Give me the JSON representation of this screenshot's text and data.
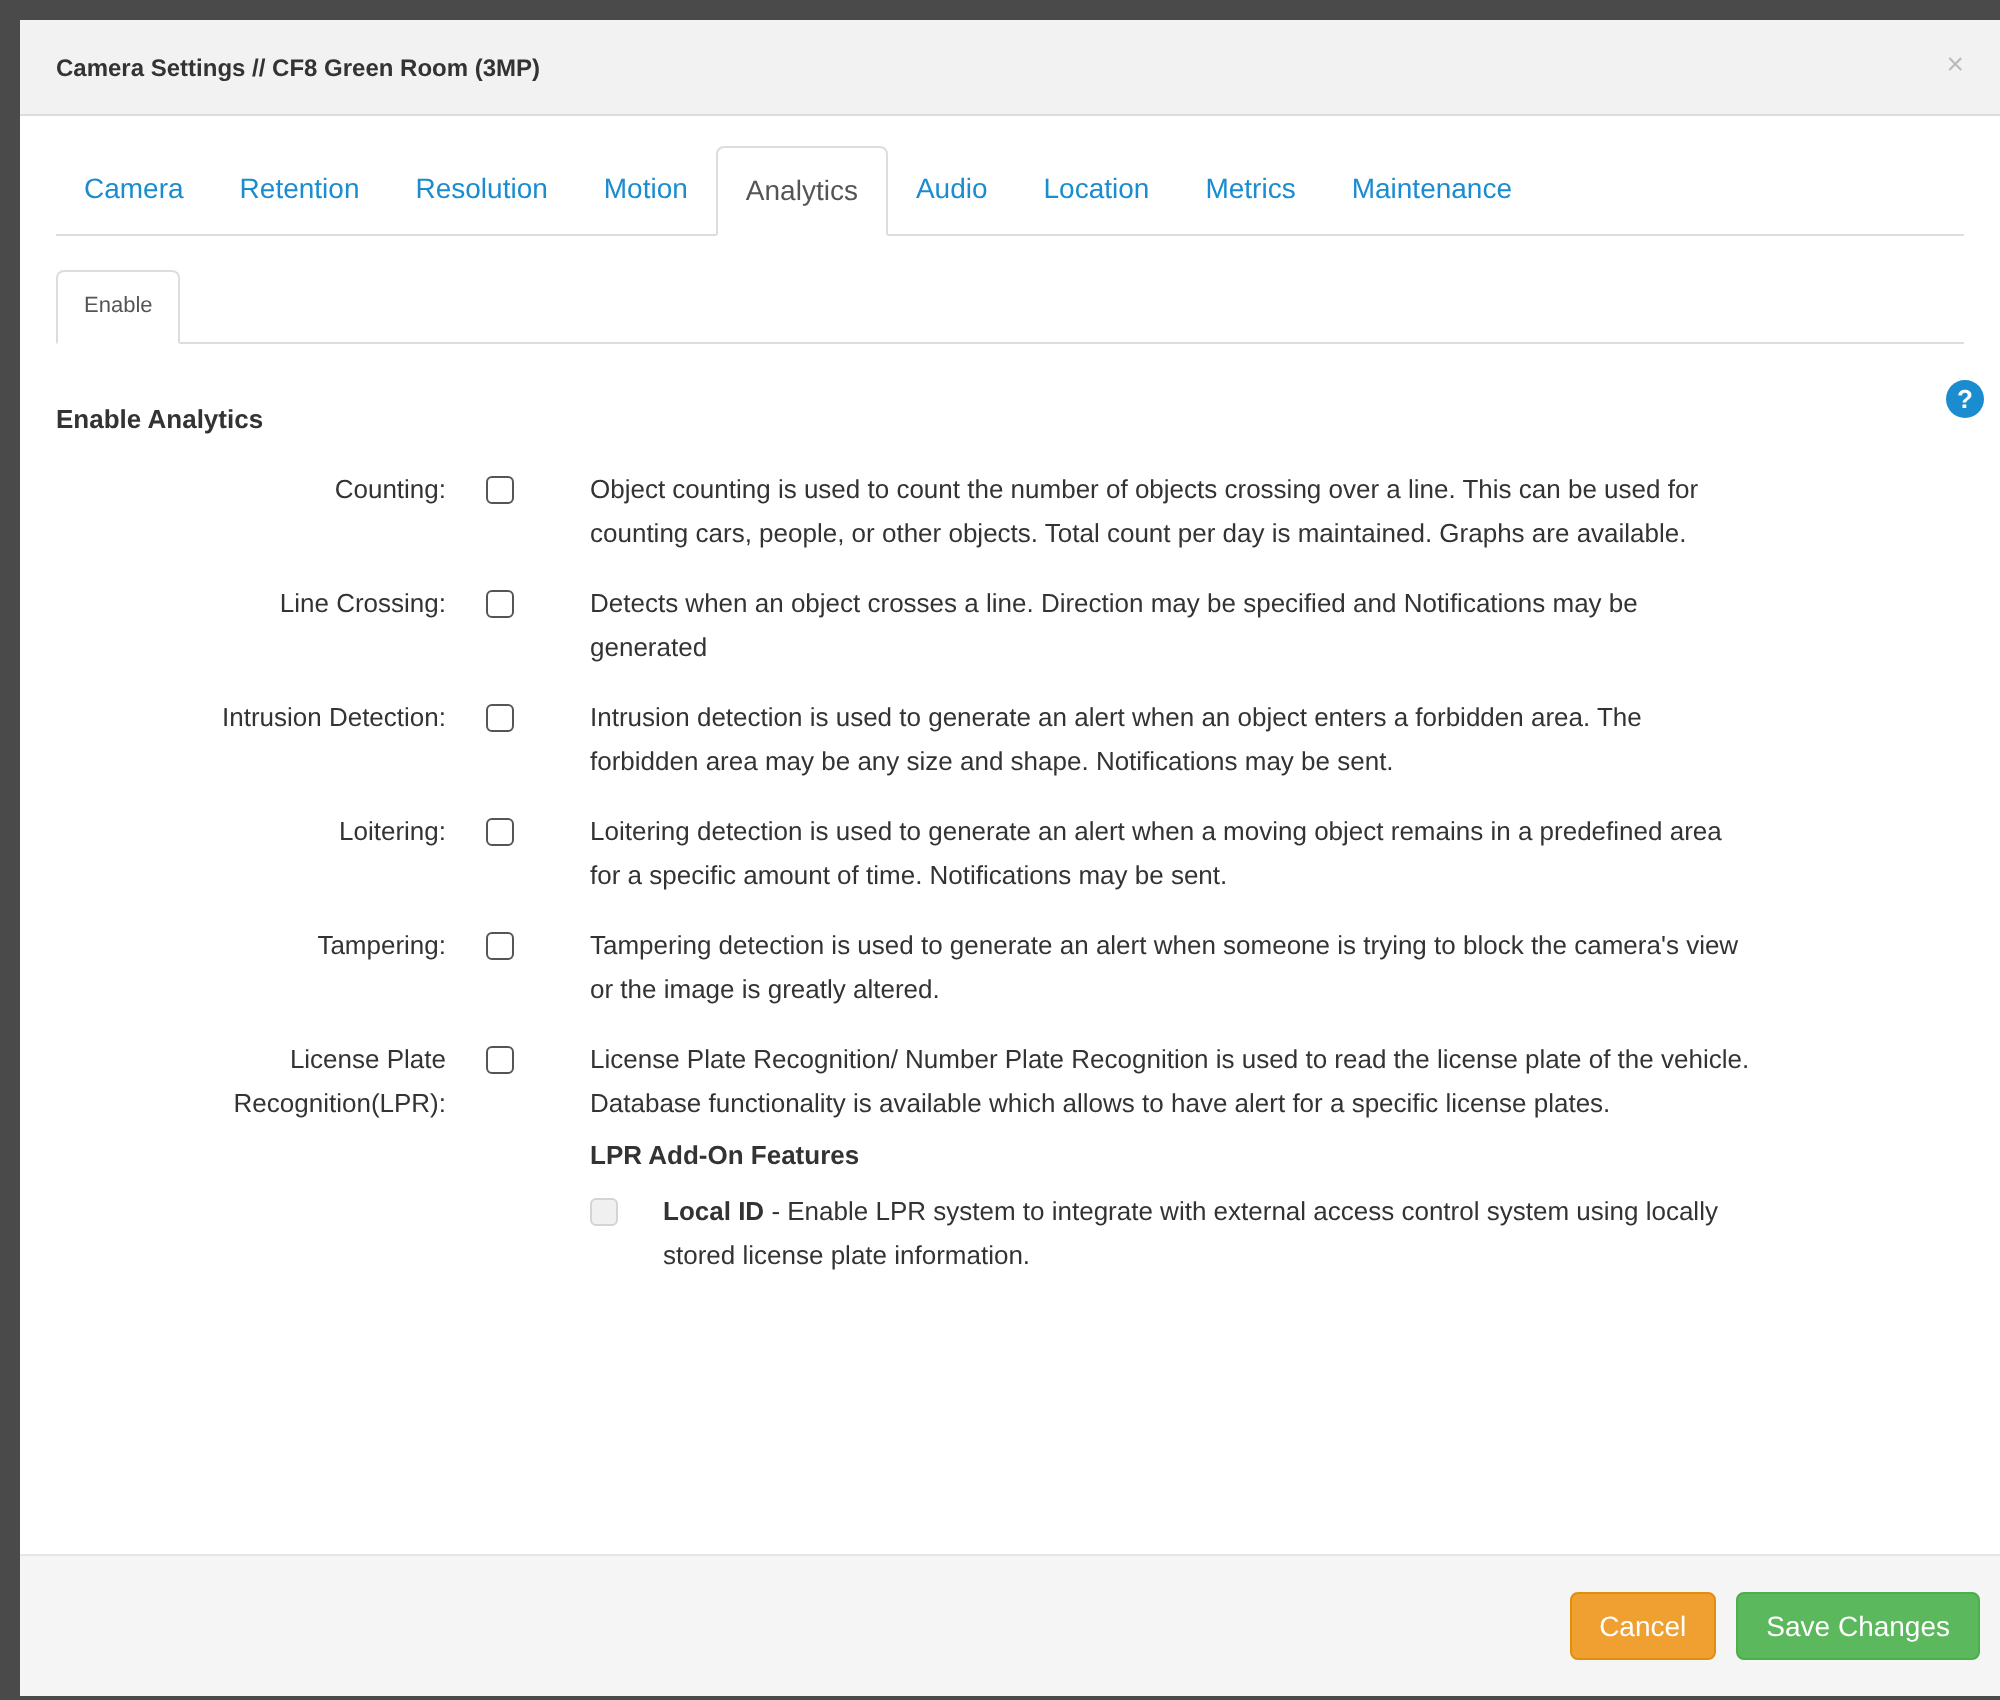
{
  "window": {
    "title": "Camera Settings // CF8 Green Room (3MP)",
    "close": "×"
  },
  "tabs": [
    {
      "label": "Camera",
      "selected": false
    },
    {
      "label": "Retention",
      "selected": false
    },
    {
      "label": "Resolution",
      "selected": false
    },
    {
      "label": "Motion",
      "selected": false
    },
    {
      "label": "Analytics",
      "selected": true
    },
    {
      "label": "Audio",
      "selected": false
    },
    {
      "label": "Location",
      "selected": false
    },
    {
      "label": "Metrics",
      "selected": false
    },
    {
      "label": "Maintenance",
      "selected": false
    }
  ],
  "subtabs": [
    {
      "label": "Enable",
      "selected": true
    }
  ],
  "section": {
    "title": "Enable Analytics",
    "help": "?"
  },
  "options": [
    {
      "label": "Counting:",
      "checked": false,
      "description": "Object counting is used to count the number of objects crossing over a line. This can be used for counting cars, people, or other objects. Total count per day is maintained. Graphs are available."
    },
    {
      "label": "Line Crossing:",
      "checked": false,
      "description": "Detects when an object crosses a line. Direction may be specified and Notifications may be generated"
    },
    {
      "label": "Intrusion Detection:",
      "checked": false,
      "description": "Intrusion detection is used to generate an alert when an object enters a forbidden area. The forbidden area may be any size and shape. Notifications may be sent."
    },
    {
      "label": "Loitering:",
      "checked": false,
      "description": "Loitering detection is used to generate an alert when a moving object remains in a predefined area for a specific amount of time. Notifications may be sent."
    },
    {
      "label": "Tampering:",
      "checked": false,
      "description": "Tampering detection is used to generate an alert when someone is trying to block the camera's view or the image is greatly altered."
    },
    {
      "label": "License Plate Recognition(LPR):",
      "checked": false,
      "description": "License Plate Recognition/ Number Plate Recognition is used to read the license plate of the vehicle. Database functionality is available which allows to have alert for a specific license plates.",
      "addons": {
        "title": "LPR Add-On Features",
        "items": [
          {
            "text": "**Local ID** - Enable LPR system to integrate with external access control system using locally stored license plate information.",
            "checked": false,
            "disabled": true
          }
        ]
      }
    }
  ],
  "buttons": [
    {
      "label": "Cancel",
      "kind": "cancel"
    },
    {
      "label": "Save Changes",
      "kind": "primary"
    }
  ]
}
